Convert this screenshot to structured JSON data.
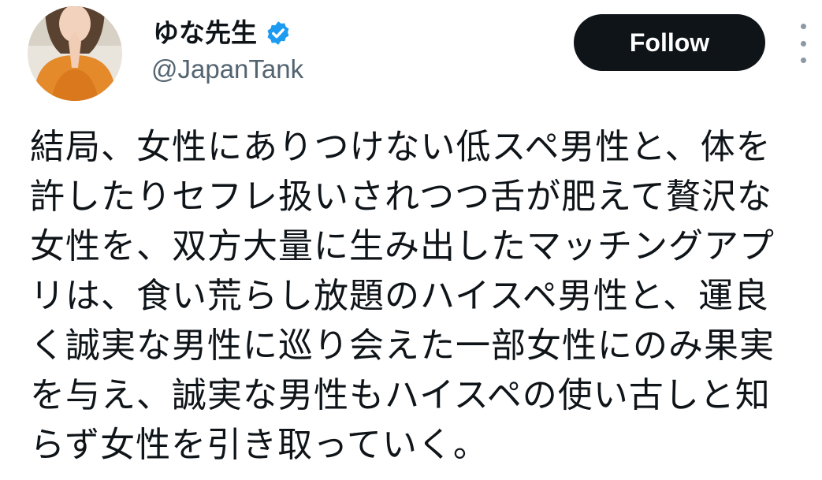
{
  "author": {
    "display_name": "ゆな先生",
    "handle": "@JapanTank",
    "verified": true,
    "avatar_icon": "profile-photo",
    "accent_color": "#1d9bf0"
  },
  "actions": {
    "follow_label": "Follow",
    "more_icon": "more-vertical-icon"
  },
  "tweet": {
    "lines": [
      "結局、女性にありつけない低スペ男性と、体を",
      "許したりセフレ扱いされつつ舌が肥えて贅沢な",
      "女性を、双方大量に生み出したマッチングアプ",
      "リは、食い荒らし放題のハイスペ男性と、運良",
      "く誠実な男性に巡り会えた一部女性にのみ果実",
      "を与え、誠実な男性もハイスペの使い古しと知",
      "らず女性を引き取っていく。"
    ]
  }
}
